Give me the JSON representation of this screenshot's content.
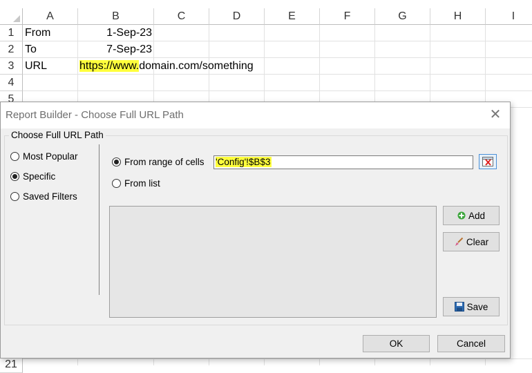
{
  "sheet": {
    "columns": [
      "A",
      "B",
      "C",
      "D",
      "E",
      "F",
      "G",
      "H",
      "I"
    ],
    "rows": [
      "1",
      "2",
      "3",
      "4",
      "5",
      "21"
    ],
    "cells": {
      "a1": "From",
      "b1": "1-Sep-23",
      "a2": "To",
      "b2": "7-Sep-23",
      "a3": "URL",
      "b3_highlight": "https://www.",
      "b3_rest": "domain.com/something"
    }
  },
  "dialog": {
    "title": "Report Builder - Choose Full URL Path",
    "group_label": "Choose Full URL Path",
    "left_options": [
      {
        "label": "Most Popular",
        "selected": false
      },
      {
        "label": "Specific",
        "selected": true
      },
      {
        "label": "Saved Filters",
        "selected": false
      }
    ],
    "source_options": [
      {
        "label": "From range of cells",
        "selected": true
      },
      {
        "label": "From list",
        "selected": false
      }
    ],
    "range_value": "'Config'!$B$3",
    "buttons": {
      "add": "Add",
      "clear": "Clear",
      "save": "Save",
      "ok": "OK",
      "cancel": "Cancel"
    },
    "colors": {
      "highlight": "#ffff3c",
      "dialog_bg": "#f0f0f0",
      "list_bg": "#e6e6e6"
    }
  }
}
